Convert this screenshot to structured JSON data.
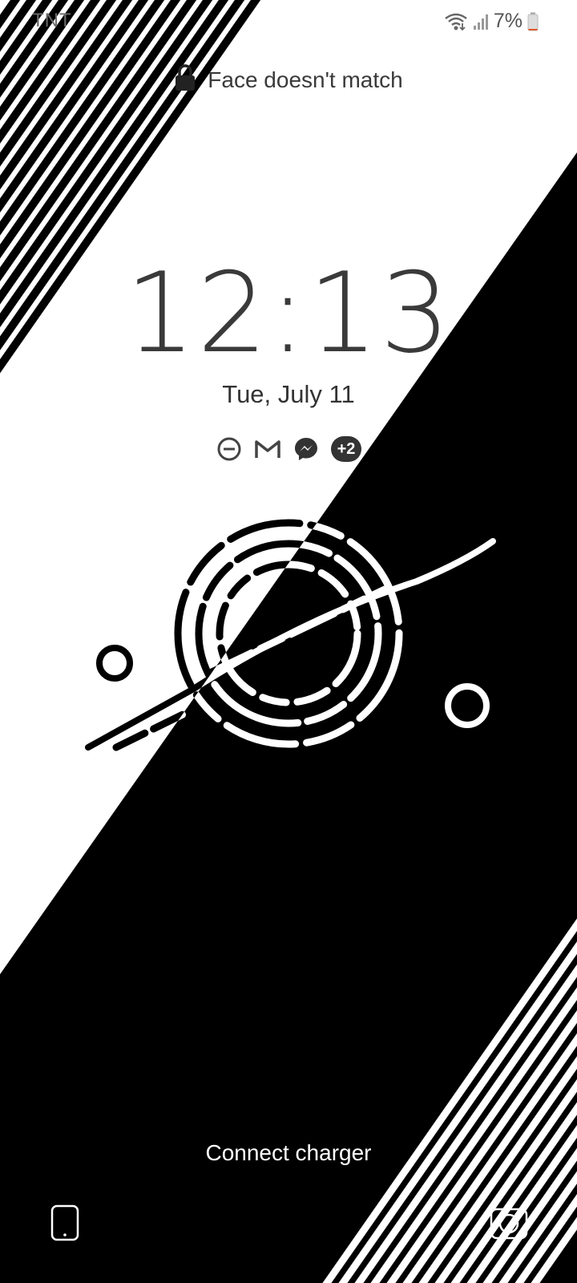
{
  "status_bar": {
    "carrier": "TNT",
    "battery_text": "7%",
    "icons": [
      "wifi-icon",
      "signal-icon",
      "battery-icon"
    ],
    "battery_level": 0.07,
    "battery_color": "#e05a2b"
  },
  "lock": {
    "message": "Face doesn't match",
    "icon": "lock-icon"
  },
  "clock": {
    "time": "12:13",
    "date": "Tue, July 11"
  },
  "notifications": {
    "icons": [
      "do-not-disturb-icon",
      "gmail-icon",
      "messenger-icon"
    ],
    "more_count": "+2"
  },
  "footer": {
    "charger_message": "Connect charger",
    "left_shortcut": "phone-icon",
    "right_shortcut": "camera-icon"
  },
  "colors": {
    "foreground": "#3a3a3a",
    "wallpaper_dark": "#000000",
    "wallpaper_light": "#ffffff"
  }
}
